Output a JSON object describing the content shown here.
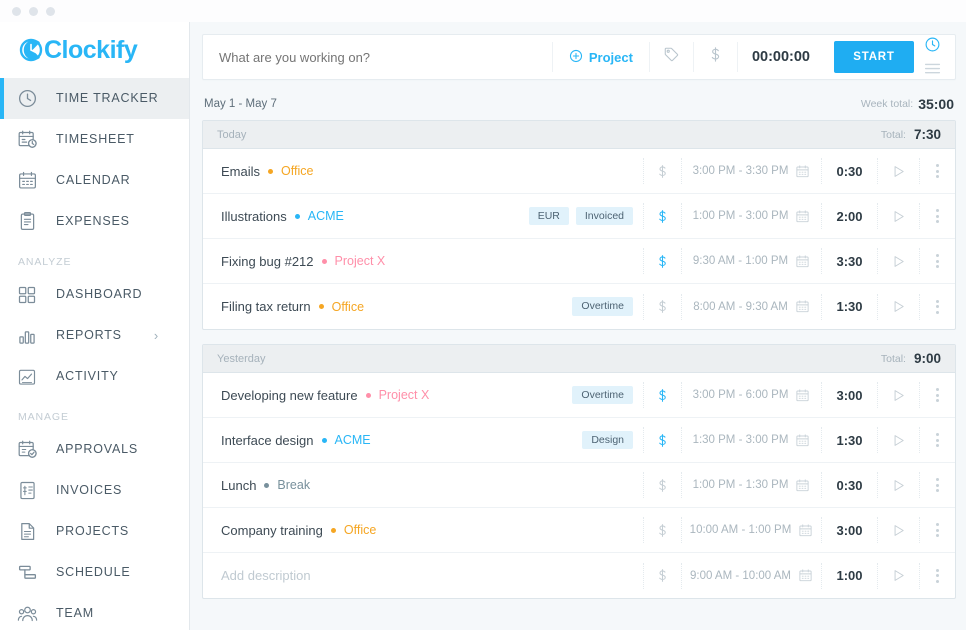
{
  "brand": {
    "name": "Clockify",
    "accent": "#29b6f6",
    "logo_icon": "clock-c-icon"
  },
  "sidebar": {
    "groups": [
      {
        "label": "",
        "items": [
          {
            "label": "TIME TRACKER",
            "icon": "clock-icon",
            "active": true
          },
          {
            "label": "TIMESHEET",
            "icon": "calendar-clock-icon",
            "active": false
          },
          {
            "label": "CALENDAR",
            "icon": "calendar-icon",
            "active": false
          },
          {
            "label": "EXPENSES",
            "icon": "receipt-icon",
            "active": false
          }
        ]
      },
      {
        "label": "ANALYZE",
        "items": [
          {
            "label": "DASHBOARD",
            "icon": "grid-icon",
            "active": false
          },
          {
            "label": "REPORTS",
            "icon": "bar-chart-icon",
            "active": false,
            "chevron": "›"
          },
          {
            "label": "ACTIVITY",
            "icon": "line-chart-icon",
            "active": false
          }
        ]
      },
      {
        "label": "MANAGE",
        "items": [
          {
            "label": "APPROVALS",
            "icon": "calendar-check-icon",
            "active": false
          },
          {
            "label": "INVOICES",
            "icon": "invoice-icon",
            "active": false
          },
          {
            "label": "PROJECTS",
            "icon": "document-icon",
            "active": false
          },
          {
            "label": "SCHEDULE",
            "icon": "schedule-icon",
            "active": false
          },
          {
            "label": "TEAM",
            "icon": "people-icon",
            "active": false
          }
        ]
      }
    ]
  },
  "timer": {
    "placeholder": "What are you working on?",
    "value": "",
    "project_label": "Project",
    "project_icon": "plus-circle-icon",
    "tag_icon": "tag-icon",
    "billable_icon": "dollar-icon",
    "elapsed": "00:00:00",
    "start_label": "START",
    "mode_icons": [
      "clock-icon",
      "list-icon"
    ]
  },
  "week": {
    "range": "May 1 - May 7",
    "total_label": "Week total:",
    "total_value": "35:00"
  },
  "groups": [
    {
      "title": "Today",
      "total_label": "Total:",
      "total_value": "7:30",
      "entries": [
        {
          "description": "Emails",
          "placeholder": false,
          "project": "Office",
          "project_color": "#f5a623",
          "tags": [],
          "billable": false,
          "time_range": "3:00 PM - 3:30 PM",
          "duration": "0:30"
        },
        {
          "description": "Illustrations",
          "placeholder": false,
          "project": "ACME",
          "project_color": "#29b6f6",
          "tags": [
            "EUR",
            "Invoiced"
          ],
          "billable": true,
          "time_range": "1:00 PM - 3:00 PM",
          "duration": "2:00"
        },
        {
          "description": "Fixing bug #212",
          "placeholder": false,
          "project": "Project X",
          "project_color": "#ff8fa9",
          "tags": [],
          "billable": true,
          "time_range": "9:30 AM - 1:00 PM",
          "duration": "3:30"
        },
        {
          "description": "Filing tax return",
          "placeholder": false,
          "project": "Office",
          "project_color": "#f5a623",
          "tags": [
            "Overtime"
          ],
          "billable": false,
          "time_range": "8:00 AM - 9:30 AM",
          "duration": "1:30"
        }
      ]
    },
    {
      "title": "Yesterday",
      "total_label": "Total:",
      "total_value": "9:00",
      "entries": [
        {
          "description": "Developing new feature",
          "placeholder": false,
          "project": "Project X",
          "project_color": "#ff8fa9",
          "tags": [
            "Overtime"
          ],
          "billable": true,
          "time_range": "3:00 PM - 6:00 PM",
          "duration": "3:00"
        },
        {
          "description": "Interface design",
          "placeholder": false,
          "project": "ACME",
          "project_color": "#29b6f6",
          "tags": [
            "Design"
          ],
          "billable": true,
          "time_range": "1:30 PM - 3:00 PM",
          "duration": "1:30"
        },
        {
          "description": "Lunch",
          "placeholder": false,
          "project": "Break",
          "project_color": "#78909c",
          "tags": [],
          "billable": false,
          "time_range": "1:00 PM - 1:30 PM",
          "duration": "0:30"
        },
        {
          "description": "Company training",
          "placeholder": false,
          "project": "Office",
          "project_color": "#f5a623",
          "tags": [],
          "billable": false,
          "time_range": "10:00 AM - 1:00 PM",
          "duration": "3:00"
        },
        {
          "description": "Add description",
          "placeholder": true,
          "project": "",
          "project_color": "",
          "tags": [],
          "billable": false,
          "time_range": "9:00 AM - 10:00 AM",
          "duration": "1:00"
        }
      ]
    }
  ]
}
